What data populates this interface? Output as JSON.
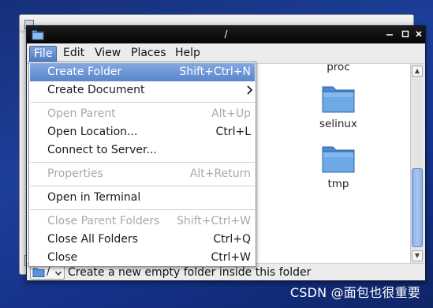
{
  "window": {
    "title": "/"
  },
  "background_window": {
    "title_fragment": ""
  },
  "menubar": {
    "items": [
      "File",
      "Edit",
      "View",
      "Places",
      "Help"
    ]
  },
  "file_menu": {
    "items": [
      {
        "label": "Create Folder",
        "accel": "Shift+Ctrl+N",
        "state": "highlighted"
      },
      {
        "label": "Create Document",
        "accel": "",
        "state": "submenu"
      },
      {
        "label": "Open Parent",
        "accel": "Alt+Up",
        "state": "disabled"
      },
      {
        "label": "Open Location...",
        "accel": "Ctrl+L",
        "state": "enabled"
      },
      {
        "label": "Connect to Server...",
        "accel": "",
        "state": "enabled"
      },
      {
        "label": "Properties",
        "accel": "Alt+Return",
        "state": "disabled"
      },
      {
        "label": "Open in Terminal",
        "accel": "",
        "state": "enabled"
      },
      {
        "label": "Close Parent Folders",
        "accel": "Shift+Ctrl+W",
        "state": "disabled"
      },
      {
        "label": "Close All Folders",
        "accel": "Ctrl+Q",
        "state": "enabled"
      },
      {
        "label": "Close",
        "accel": "Ctrl+W",
        "state": "enabled"
      }
    ],
    "submenu_arrow": ">"
  },
  "folders": [
    {
      "name": "proc"
    },
    {
      "name": "selinux"
    },
    {
      "name": "tmp"
    }
  ],
  "statusbar": {
    "location": "/",
    "message": "Create a new empty folder inside this folder"
  },
  "watermark": {
    "text": "CSDN @面包也很重要"
  },
  "icons": {
    "window": "folder-icon",
    "minimize": "minimize-icon",
    "maximize": "maximize-icon",
    "close": "close-icon",
    "folder": "folder-icon",
    "scroll_up": "arrow-up-icon",
    "scroll_down": "arrow-down-icon",
    "submenu": "chevron-right-icon",
    "dropdown": "chevron-down-icon"
  },
  "colors": {
    "desktop": "#1c3f9a",
    "titlebar": "#0d0d0d",
    "highlight": "#5a86cc",
    "folder": "#5b9bd8",
    "scrollbar_thumb": "#a9c6f0",
    "disabled_text": "#a8a8a8"
  }
}
